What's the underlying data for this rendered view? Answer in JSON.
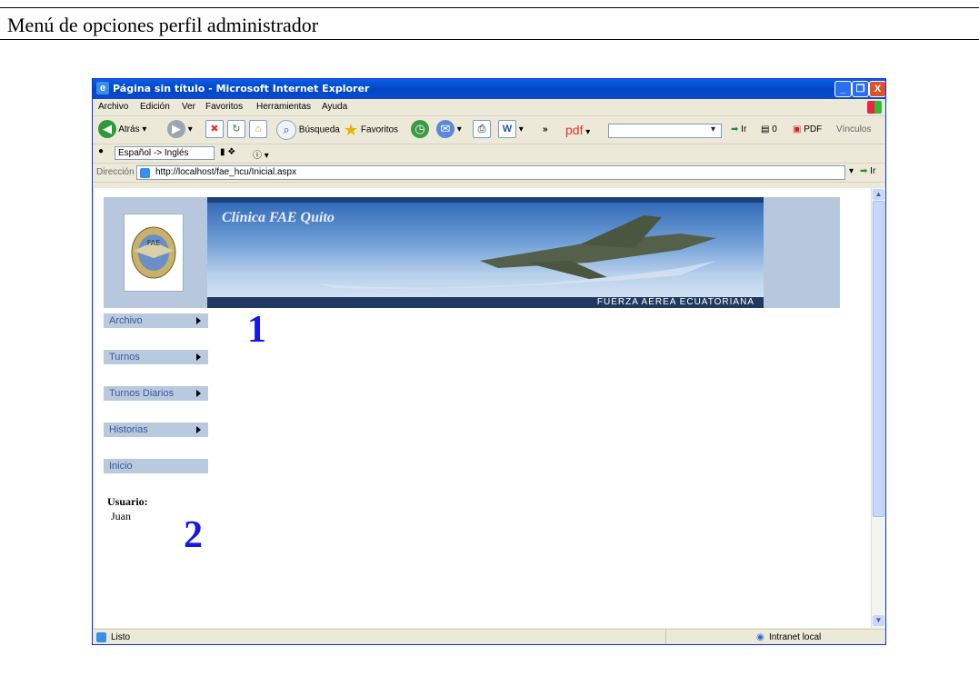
{
  "document": {
    "heading": "Menú de opciones  perfil administrador",
    "callout_1": "1",
    "callout_2": "2"
  },
  "window": {
    "title": "Página sin título - Microsoft Internet Explorer",
    "controls": [
      "_",
      "❐",
      "X"
    ]
  },
  "menubar": {
    "items": [
      "Archivo",
      "Edición",
      "Ver",
      "Favoritos",
      "Herramientas",
      "Ayuda"
    ]
  },
  "toolbar": {
    "back_label": "Atrás",
    "search_label": "Búsqueda",
    "favorites_label": "Favoritos",
    "pdf_label": "pdf",
    "go_label": "Ir",
    "count_label": "0",
    "pdf_button_label": "PDF",
    "links_label": "Vínculos"
  },
  "langbar": {
    "translation": "Español -> Inglés"
  },
  "addressbar": {
    "label": "Dirección",
    "url": "http://localhost/fae_hcu/Inicial.aspx",
    "go_label": "Ir"
  },
  "page": {
    "banner_title": "Clínica FAE Quito",
    "banner_subtitle": "FUERZA AÉREA ECUATORIANA",
    "logo_text": "FAE",
    "menu": [
      {
        "label": "Archivo",
        "has_submenu": true
      },
      {
        "label": "Turnos",
        "has_submenu": true
      },
      {
        "label": "Turnos Diarios",
        "has_submenu": true
      },
      {
        "label": "Historias",
        "has_submenu": true
      },
      {
        "label": "Inicio",
        "has_submenu": false
      }
    ],
    "user_label": "Usuario:",
    "user_name": "Juan"
  },
  "statusbar": {
    "status": "Listo",
    "zone": "Intranet local"
  },
  "colors": {
    "callout": "#1717e6",
    "menu_bg": "#b9c9de",
    "menu_text": "#3a5a98",
    "titlebar": "#0346c6"
  }
}
